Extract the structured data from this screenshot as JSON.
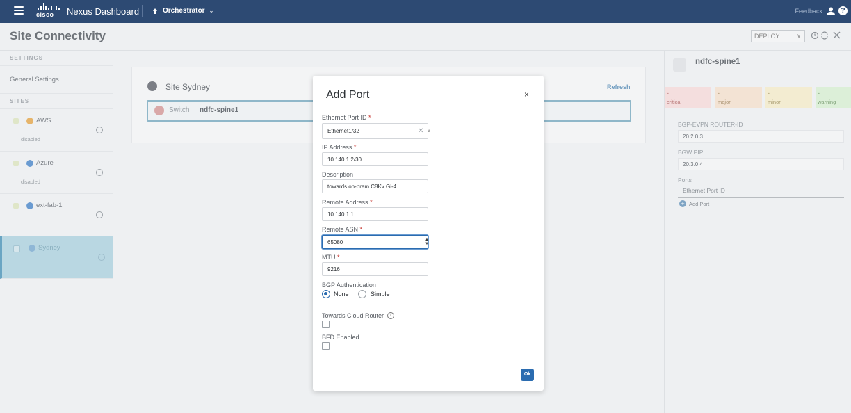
{
  "topbar": {
    "logo_text": "cisco",
    "app_title": "Nexus Dashboard",
    "service": "Orchestrator",
    "feedback": "Feedback",
    "help": "?"
  },
  "page": {
    "title": "Site Connectivity",
    "deploy_value": "DEPLOY"
  },
  "leftnav": {
    "settings_header": "SETTINGS",
    "general_settings": "General Settings",
    "sites_header": "SITES",
    "sites": [
      {
        "name": "AWS",
        "status": "disabled",
        "icon_color": "#e6b46a"
      },
      {
        "name": "Azure",
        "status": "disabled",
        "icon_color": "#6a9bd1"
      },
      {
        "name": "ext-fab-1",
        "status": "",
        "icon_color": "#6a9bd1"
      },
      {
        "name": "Sydney",
        "status": "",
        "icon_color": "#6a9bd1",
        "selected": true
      }
    ]
  },
  "canvas": {
    "site_title": "Site Sydney",
    "refresh": "Refresh",
    "switch_label": "Switch",
    "switch_name": "ndfc-spine1"
  },
  "rightpanel": {
    "title": "ndfc-spine1",
    "severity": [
      {
        "value": "-",
        "label": "critical",
        "bg": "#f4dede",
        "fg": "#b87777"
      },
      {
        "value": "-",
        "label": "major",
        "bg": "#f3e3d4",
        "fg": "#a8906e"
      },
      {
        "value": "-",
        "label": "minor",
        "bg": "#f3ecd1",
        "fg": "#a89a6e"
      },
      {
        "value": "-",
        "label": "warning",
        "bg": "#dcefd8",
        "fg": "#7ea077"
      }
    ],
    "bgp_evpn_label": "BGP-EVPN ROUTER-ID",
    "bgp_evpn_value": "20.2.0.3",
    "bgw_pip_label": "BGW PIP",
    "bgw_pip_value": "20.3.0.4",
    "ports_label": "Ports",
    "ports_col": "Ethernet Port ID",
    "add_port": "Add Port"
  },
  "modal": {
    "title": "Add Port",
    "close": "×",
    "ethernet_port_label": "Ethernet Port ID",
    "ethernet_port_value": "Ethernet1/32",
    "ip_label": "IP Address",
    "ip_value": "10.140.1.2/30",
    "description_label": "Description",
    "description_value": "towards on-prem C8Kv Gi-4",
    "remote_address_label": "Remote Address",
    "remote_address_value": "10.140.1.1",
    "remote_asn_label": "Remote ASN",
    "remote_asn_value": "65080",
    "mtu_label": "MTU",
    "mtu_value": "9216",
    "bgp_auth_label": "BGP Authentication",
    "bgp_auth_options": [
      "None",
      "Simple"
    ],
    "bgp_auth_selected": "None",
    "towards_cloud_label": "Towards Cloud Router",
    "towards_cloud_checked": false,
    "bfd_label": "BFD Enabled",
    "bfd_checked": false,
    "ok": "Ok",
    "required_mark": "*"
  }
}
